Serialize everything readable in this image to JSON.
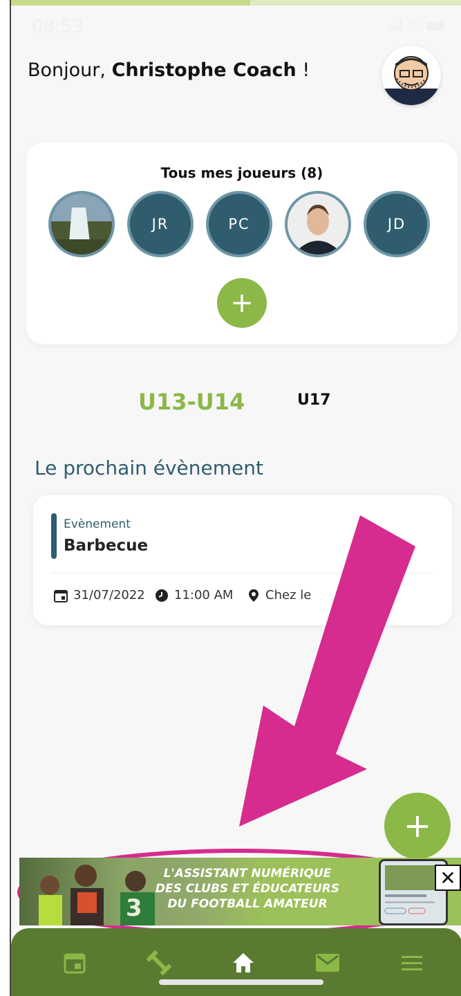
{
  "status_bar": {
    "time": "08:53"
  },
  "progress": {
    "fraction": 0.53
  },
  "greeting": {
    "prefix": "Bonjour, ",
    "name": "Christophe Coach",
    "suffix": " !"
  },
  "players": {
    "title": "Tous mes joueurs (8)",
    "items": [
      {
        "kind": "photo",
        "label": ""
      },
      {
        "kind": "initials",
        "label": "JR"
      },
      {
        "kind": "initials",
        "label": "PC"
      },
      {
        "kind": "photo",
        "label": ""
      },
      {
        "kind": "initials",
        "label": "JD"
      }
    ],
    "add_label": "+"
  },
  "teams": {
    "active": "U13-U14",
    "inactive": "U17"
  },
  "next_event": {
    "section_title": "Le prochain évènement",
    "type": "Evènement",
    "name": "Barbecue",
    "date": "31/07/2022",
    "time": "11:00 AM",
    "location": "Chez le"
  },
  "fab": {
    "label": "+"
  },
  "banner": {
    "line1": "L'ASSISTANT NUMÉRIQUE",
    "line2": "DES CLUBS ET ÉDUCATEURS",
    "line3": "DU FOOTBALL AMATEUR",
    "close": "✕"
  },
  "bottom_nav": [
    "calendar-icon",
    "exercise-icon",
    "home-icon",
    "mail-icon",
    "menu-icon"
  ],
  "colors": {
    "accent_green": "#8bb847",
    "dark_teal": "#2f5d6e",
    "nav_green": "#5b7a31",
    "annotation_pink": "#d62b8f"
  }
}
